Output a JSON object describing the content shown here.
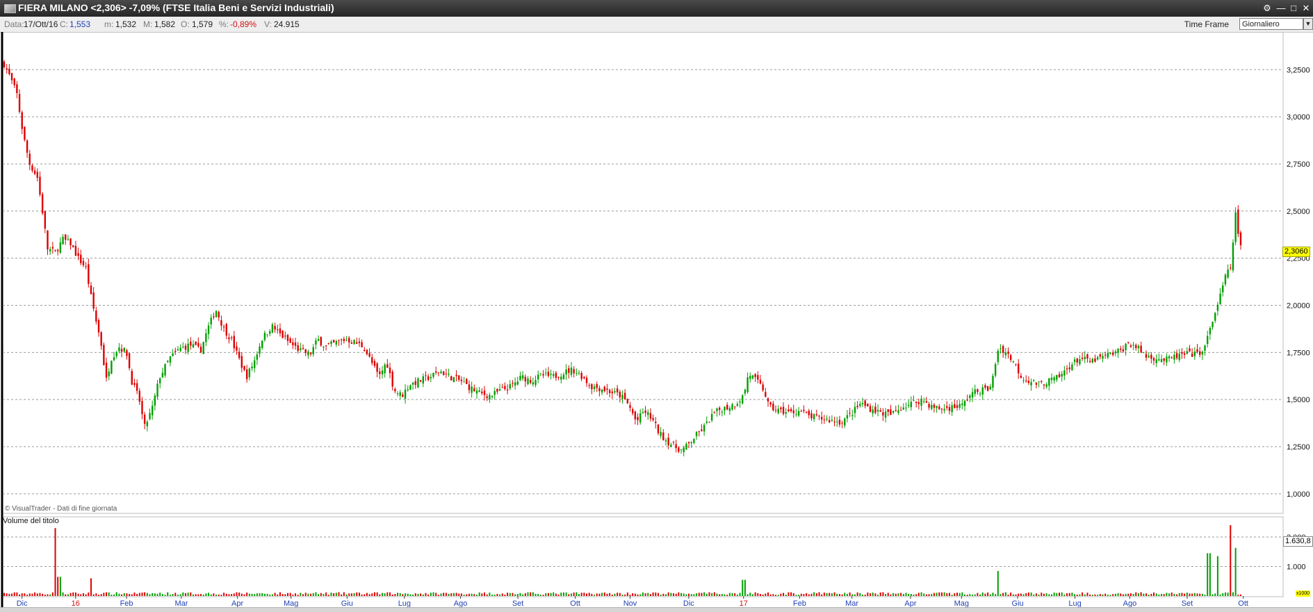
{
  "window": {
    "title": "FIERA MILANO <2,306> -7,09%  (FTSE Italia Beni e Servizi Industriali)",
    "buttons": [
      "⚙",
      "—",
      "□",
      "✕"
    ]
  },
  "infobar": {
    "date_label": "Data:",
    "date": "17/Ott/16",
    "close_label": "C:",
    "close": "1,553",
    "min_label": "m:",
    "min": "1,532",
    "max_label": "M:",
    "max": "1,582",
    "open_label": "O:",
    "open": "1,579",
    "pct_label": "%:",
    "pct": "-0,89%",
    "vol_label": "V:",
    "vol": "24.915",
    "time_frame_label": "Time Frame",
    "time_frame_value": "Giornaliero"
  },
  "copyright": "© VisualTrader - Dati di fine giornata",
  "volume_title": "Volume del titolo",
  "last_price_tag": "2,3060",
  "last_volume_tag": "1.630,8",
  "volume_unit": "x1000",
  "colors": {
    "up": "#00a000",
    "down": "#dd0000",
    "grid": "#9a9a9a",
    "month_label": "#1f3fb5",
    "year_label": "#d01010"
  },
  "chart_data": {
    "type": "candlestick",
    "price_axis": {
      "min": 0.9,
      "max": 3.45,
      "ticks": [
        "3,2500",
        "3,0000",
        "2,7500",
        "2,5000",
        "2,2500",
        "2,0000",
        "1,7500",
        "1,5000",
        "1,2500",
        "1,0000"
      ]
    },
    "volume_axis": {
      "max": 2400,
      "ticks": [
        "2.000",
        "1.000"
      ]
    },
    "x_labels": [
      {
        "label": "Dic",
        "t": 0.014
      },
      {
        "label": "16",
        "t": 0.056,
        "year": true
      },
      {
        "label": "Feb",
        "t": 0.096
      },
      {
        "label": "Mar",
        "t": 0.139
      },
      {
        "label": "Apr",
        "t": 0.183
      },
      {
        "label": "Mag",
        "t": 0.225
      },
      {
        "label": "Giu",
        "t": 0.269
      },
      {
        "label": "Lug",
        "t": 0.314
      },
      {
        "label": "Ago",
        "t": 0.358
      },
      {
        "label": "Set",
        "t": 0.403
      },
      {
        "label": "Ott",
        "t": 0.448
      },
      {
        "label": "Nov",
        "t": 0.491
      },
      {
        "label": "Dic",
        "t": 0.537
      },
      {
        "label": "17",
        "t": 0.58,
        "year": true
      },
      {
        "label": "Feb",
        "t": 0.624
      },
      {
        "label": "Mar",
        "t": 0.665
      },
      {
        "label": "Apr",
        "t": 0.711
      },
      {
        "label": "Mag",
        "t": 0.751
      },
      {
        "label": "Giu",
        "t": 0.795
      },
      {
        "label": "Lug",
        "t": 0.84
      },
      {
        "label": "Ago",
        "t": 0.883
      },
      {
        "label": "Set",
        "t": 0.928
      },
      {
        "label": "Ott",
        "t": 0.972
      }
    ],
    "close_trend": [
      [
        0.0,
        3.28
      ],
      [
        0.004,
        3.22
      ],
      [
        0.01,
        3.12
      ],
      [
        0.015,
        2.9
      ],
      [
        0.02,
        2.75
      ],
      [
        0.026,
        2.68
      ],
      [
        0.03,
        2.5
      ],
      [
        0.034,
        2.3
      ],
      [
        0.04,
        2.28
      ],
      [
        0.046,
        2.35
      ],
      [
        0.052,
        2.33
      ],
      [
        0.058,
        2.25
      ],
      [
        0.064,
        2.2
      ],
      [
        0.068,
        2.05
      ],
      [
        0.072,
        1.92
      ],
      [
        0.076,
        1.8
      ],
      [
        0.08,
        1.6
      ],
      [
        0.084,
        1.72
      ],
      [
        0.09,
        1.78
      ],
      [
        0.096,
        1.75
      ],
      [
        0.1,
        1.6
      ],
      [
        0.106,
        1.5
      ],
      [
        0.11,
        1.35
      ],
      [
        0.116,
        1.45
      ],
      [
        0.122,
        1.62
      ],
      [
        0.13,
        1.72
      ],
      [
        0.138,
        1.77
      ],
      [
        0.146,
        1.79
      ],
      [
        0.154,
        1.76
      ],
      [
        0.16,
        1.88
      ],
      [
        0.166,
        1.98
      ],
      [
        0.172,
        1.88
      ],
      [
        0.178,
        1.82
      ],
      [
        0.184,
        1.72
      ],
      [
        0.19,
        1.62
      ],
      [
        0.196,
        1.7
      ],
      [
        0.202,
        1.82
      ],
      [
        0.21,
        1.89
      ],
      [
        0.216,
        1.85
      ],
      [
        0.224,
        1.8
      ],
      [
        0.232,
        1.76
      ],
      [
        0.24,
        1.74
      ],
      [
        0.246,
        1.82
      ],
      [
        0.252,
        1.78
      ],
      [
        0.26,
        1.8
      ],
      [
        0.268,
        1.82
      ],
      [
        0.276,
        1.8
      ],
      [
        0.282,
        1.78
      ],
      [
        0.288,
        1.7
      ],
      [
        0.294,
        1.62
      ],
      [
        0.3,
        1.7
      ],
      [
        0.306,
        1.55
      ],
      [
        0.312,
        1.52
      ],
      [
        0.318,
        1.58
      ],
      [
        0.326,
        1.6
      ],
      [
        0.334,
        1.62
      ],
      [
        0.342,
        1.65
      ],
      [
        0.35,
        1.62
      ],
      [
        0.358,
        1.6
      ],
      [
        0.366,
        1.56
      ],
      [
        0.374,
        1.53
      ],
      [
        0.382,
        1.52
      ],
      [
        0.39,
        1.55
      ],
      [
        0.398,
        1.57
      ],
      [
        0.406,
        1.62
      ],
      [
        0.414,
        1.6
      ],
      [
        0.422,
        1.63
      ],
      [
        0.43,
        1.62
      ],
      [
        0.438,
        1.64
      ],
      [
        0.446,
        1.66
      ],
      [
        0.454,
        1.62
      ],
      [
        0.46,
        1.57
      ],
      [
        0.468,
        1.56
      ],
      [
        0.476,
        1.54
      ],
      [
        0.484,
        1.52
      ],
      [
        0.49,
        1.47
      ],
      [
        0.496,
        1.38
      ],
      [
        0.502,
        1.44
      ],
      [
        0.508,
        1.4
      ],
      [
        0.514,
        1.32
      ],
      [
        0.52,
        1.28
      ],
      [
        0.526,
        1.25
      ],
      [
        0.532,
        1.23
      ],
      [
        0.538,
        1.27
      ],
      [
        0.544,
        1.32
      ],
      [
        0.55,
        1.36
      ],
      [
        0.556,
        1.42
      ],
      [
        0.562,
        1.45
      ],
      [
        0.568,
        1.46
      ],
      [
        0.574,
        1.48
      ],
      [
        0.58,
        1.52
      ],
      [
        0.584,
        1.64
      ],
      [
        0.59,
        1.6
      ],
      [
        0.596,
        1.55
      ],
      [
        0.6,
        1.46
      ],
      [
        0.608,
        1.44
      ],
      [
        0.616,
        1.43
      ],
      [
        0.624,
        1.44
      ],
      [
        0.632,
        1.41
      ],
      [
        0.64,
        1.4
      ],
      [
        0.648,
        1.39
      ],
      [
        0.656,
        1.38
      ],
      [
        0.664,
        1.42
      ],
      [
        0.672,
        1.48
      ],
      [
        0.68,
        1.45
      ],
      [
        0.688,
        1.43
      ],
      [
        0.696,
        1.42
      ],
      [
        0.704,
        1.46
      ],
      [
        0.712,
        1.48
      ],
      [
        0.72,
        1.5
      ],
      [
        0.728,
        1.46
      ],
      [
        0.736,
        1.45
      ],
      [
        0.744,
        1.46
      ],
      [
        0.752,
        1.47
      ],
      [
        0.758,
        1.53
      ],
      [
        0.766,
        1.55
      ],
      [
        0.774,
        1.56
      ],
      [
        0.78,
        1.78
      ],
      [
        0.786,
        1.75
      ],
      [
        0.792,
        1.7
      ],
      [
        0.798,
        1.62
      ],
      [
        0.804,
        1.6
      ],
      [
        0.812,
        1.58
      ],
      [
        0.82,
        1.6
      ],
      [
        0.828,
        1.62
      ],
      [
        0.836,
        1.68
      ],
      [
        0.844,
        1.72
      ],
      [
        0.852,
        1.7
      ],
      [
        0.86,
        1.72
      ],
      [
        0.868,
        1.74
      ],
      [
        0.876,
        1.76
      ],
      [
        0.882,
        1.8
      ],
      [
        0.888,
        1.78
      ],
      [
        0.896,
        1.73
      ],
      [
        0.904,
        1.72
      ],
      [
        0.912,
        1.71
      ],
      [
        0.92,
        1.73
      ],
      [
        0.928,
        1.74
      ],
      [
        0.936,
        1.74
      ],
      [
        0.942,
        1.78
      ],
      [
        0.948,
        1.92
      ],
      [
        0.954,
        2.05
      ],
      [
        0.958,
        2.15
      ],
      [
        0.962,
        2.2
      ],
      [
        0.966,
        2.48
      ],
      [
        0.97,
        2.306
      ]
    ],
    "volume_spikes": [
      [
        0.04,
        2300
      ],
      [
        0.043,
        650
      ],
      [
        0.068,
        600
      ],
      [
        0.58,
        550
      ],
      [
        0.78,
        850
      ],
      [
        0.945,
        1450
      ],
      [
        0.952,
        1350
      ],
      [
        0.962,
        2400
      ],
      [
        0.966,
        1630
      ]
    ]
  }
}
